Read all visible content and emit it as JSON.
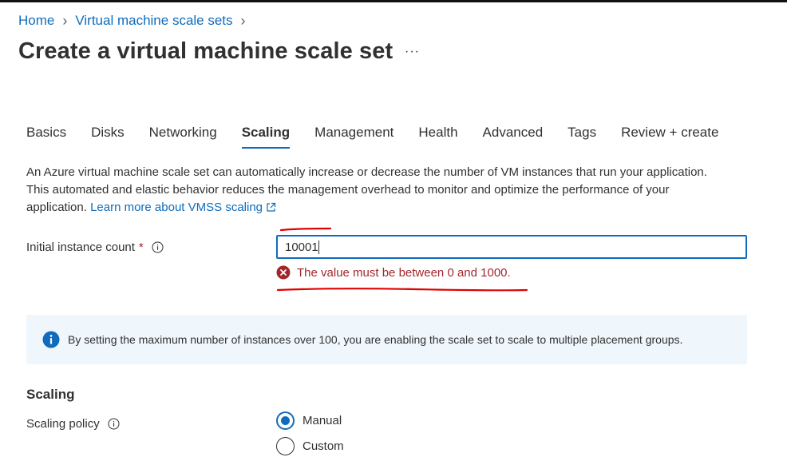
{
  "breadcrumb": {
    "items": [
      "Home",
      "Virtual machine scale sets"
    ]
  },
  "page": {
    "title": "Create a virtual machine scale set",
    "more_label": "···"
  },
  "tabs": [
    {
      "label": "Basics",
      "active": false
    },
    {
      "label": "Disks",
      "active": false
    },
    {
      "label": "Networking",
      "active": false
    },
    {
      "label": "Scaling",
      "active": true
    },
    {
      "label": "Management",
      "active": false
    },
    {
      "label": "Health",
      "active": false
    },
    {
      "label": "Advanced",
      "active": false
    },
    {
      "label": "Tags",
      "active": false
    },
    {
      "label": "Review + create",
      "active": false
    }
  ],
  "description": {
    "text": "An Azure virtual machine scale set can automatically increase or decrease the number of VM instances that run your application. This automated and elastic behavior reduces the management overhead to monitor and optimize the performance of your application.",
    "link_label": "Learn more about VMSS scaling"
  },
  "instance_count": {
    "label": "Initial instance count",
    "required_mark": "*",
    "value": "10001",
    "error": "The value must be between 0 and 1000."
  },
  "info_bar": {
    "text": "By setting the maximum number of instances over 100, you are enabling the scale set to scale to multiple placement groups."
  },
  "scaling": {
    "section_title": "Scaling",
    "policy_label": "Scaling policy",
    "options": [
      {
        "label": "Manual",
        "selected": true
      },
      {
        "label": "Custom",
        "selected": false
      }
    ]
  },
  "colors": {
    "accent": "#0f6cbd",
    "error": "#a4262c",
    "info_background": "#eff6fc",
    "annotation": "#e00000"
  }
}
